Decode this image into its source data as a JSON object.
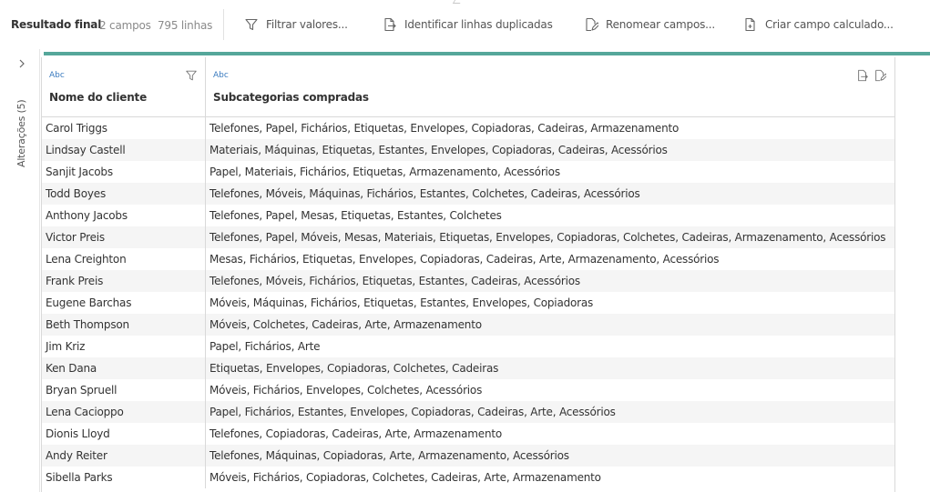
{
  "toolbar": {
    "title": "Resultado final",
    "fields_count": "2 campos",
    "rows_count": "795 linhas",
    "filter_label": "Filtrar valores...",
    "duplicates_label": "Identificar linhas duplicadas",
    "rename_label": "Renomear campos...",
    "calc_label": "Criar campo calculado..."
  },
  "left_panel": {
    "changes_label": "Alterações (5)"
  },
  "grid": {
    "columns": [
      {
        "type": "Abc",
        "name": "Nome do cliente"
      },
      {
        "type": "Abc",
        "name": "Subcategorias compradas"
      }
    ],
    "rows": [
      {
        "name": "Carol Triggs",
        "subcats": "Telefones, Papel, Fichários, Etiquetas, Envelopes, Copiadoras, Cadeiras, Armazenamento"
      },
      {
        "name": "Lindsay Castell",
        "subcats": "Materiais, Máquinas, Etiquetas, Estantes, Envelopes, Copiadoras, Cadeiras, Acessórios"
      },
      {
        "name": "Sanjit Jacobs",
        "subcats": "Papel, Materiais, Fichários, Etiquetas, Armazenamento, Acessórios"
      },
      {
        "name": "Todd Boyes",
        "subcats": "Telefones, Móveis, Máquinas, Fichários, Estantes, Colchetes, Cadeiras, Acessórios"
      },
      {
        "name": "Anthony Jacobs",
        "subcats": "Telefones, Papel, Mesas, Etiquetas, Estantes, Colchetes"
      },
      {
        "name": "Victor Preis",
        "subcats": "Telefones, Papel, Móveis, Mesas, Materiais, Etiquetas, Envelopes, Copiadoras, Colchetes, Cadeiras, Armazenamento, Acessórios"
      },
      {
        "name": "Lena Creighton",
        "subcats": "Mesas, Fichários, Etiquetas, Envelopes, Copiadoras, Cadeiras, Arte, Armazenamento, Acessórios"
      },
      {
        "name": "Frank Preis",
        "subcats": "Telefones, Móveis, Fichários, Etiquetas, Estantes, Cadeiras, Acessórios"
      },
      {
        "name": "Eugene Barchas",
        "subcats": "Móveis, Máquinas, Fichários, Etiquetas, Estantes, Envelopes, Copiadoras"
      },
      {
        "name": "Beth Thompson",
        "subcats": "Móveis, Colchetes, Cadeiras, Arte, Armazenamento"
      },
      {
        "name": "Jim Kriz",
        "subcats": "Papel, Fichários, Arte"
      },
      {
        "name": "Ken Dana",
        "subcats": "Etiquetas, Envelopes, Copiadoras, Colchetes, Cadeiras"
      },
      {
        "name": "Bryan Spruell",
        "subcats": "Móveis, Fichários, Envelopes, Colchetes, Acessórios"
      },
      {
        "name": "Lena Cacioppo",
        "subcats": "Papel, Fichários, Estantes, Envelopes, Copiadoras, Cadeiras, Arte, Acessórios"
      },
      {
        "name": "Dionis Lloyd",
        "subcats": "Telefones, Copiadoras, Cadeiras, Arte, Armazenamento"
      },
      {
        "name": "Andy Reiter",
        "subcats": "Telefones, Máquinas, Copiadoras, Arte, Armazenamento, Acessórios"
      },
      {
        "name": "Sibella Parks",
        "subcats": "Móveis, Fichários, Copiadoras, Colchetes, Cadeiras, Arte, Armazenamento"
      }
    ]
  },
  "colors": {
    "accent": "#55a79a",
    "type_label": "#3b7bbf"
  }
}
